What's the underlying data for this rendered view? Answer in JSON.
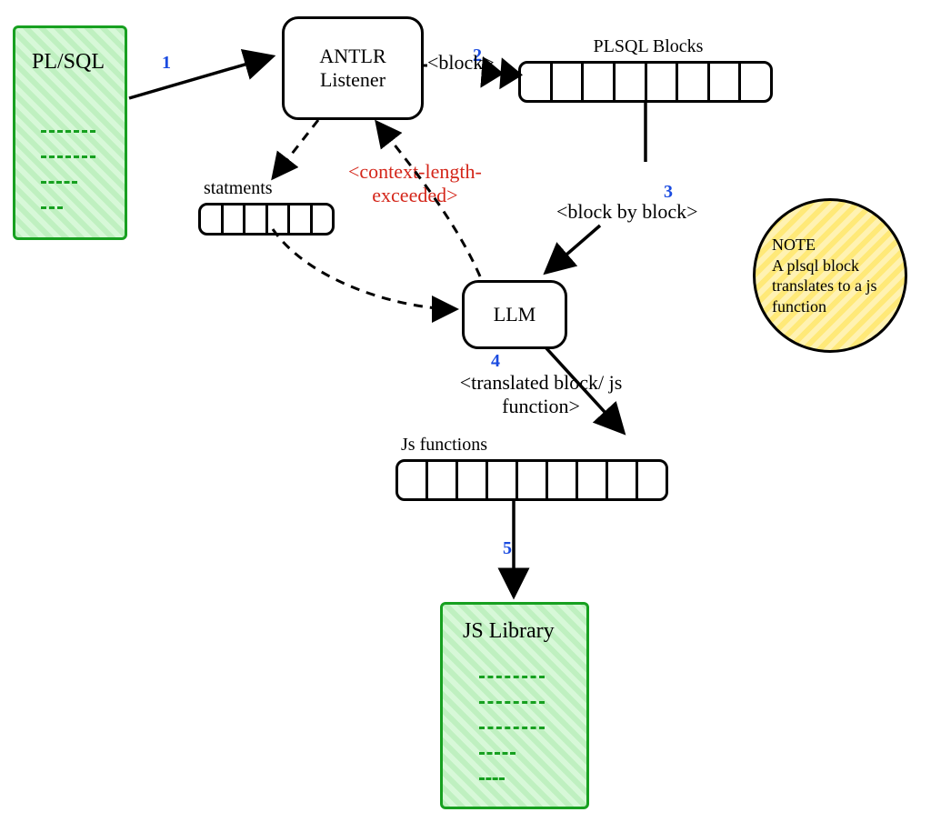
{
  "plsql": {
    "title": "PL/SQL"
  },
  "antlr": {
    "title": "ANTLR\nListener"
  },
  "llm": {
    "title": "LLM"
  },
  "jslib": {
    "title": "JS Library"
  },
  "tapes": {
    "plsql_blocks": "PLSQL Blocks",
    "statements": "statments",
    "js_functions": "Js functions"
  },
  "edges": {
    "block": "<block>",
    "ctx_exceeded": "<context-length-\nexceeded>",
    "block_by": "<block by block>",
    "translated": "<translated block/ js\nfunction>"
  },
  "steps": {
    "s1": "1",
    "s2": "2",
    "s3": "3",
    "s4": "4",
    "s5": "5"
  },
  "note": "NOTE\nA plsql block translates to a js function"
}
